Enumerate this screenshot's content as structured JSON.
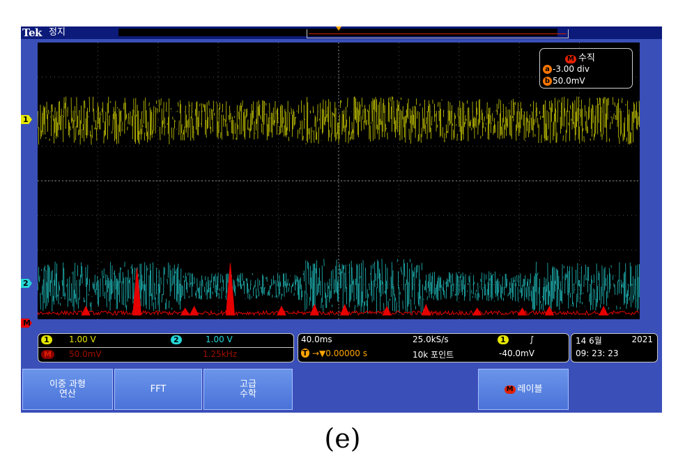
{
  "header": {
    "brand": "Tek",
    "state": "정지"
  },
  "vertical_panel": {
    "title_badge": "M",
    "title": "수직",
    "row_a_badge": "a",
    "row_a_value": "-3.00 div",
    "row_b_badge": "b",
    "row_b_value": "50.0mV"
  },
  "markers": {
    "ch1": "1",
    "ch2": "2",
    "math": "M"
  },
  "channels": {
    "ch1_badge": "1",
    "ch1_scale": "1.00 V",
    "ch2_badge": "2",
    "ch2_scale": "1.00 V",
    "math_badge": "M",
    "math_scale": "50.0mV",
    "math_freq": "1.25kHz"
  },
  "horizontal": {
    "time_div": "40.0ms",
    "sample_rate": "25.0kS/s",
    "trigger_pos_icon": "T",
    "trigger_pos": "→▼0.00000 s",
    "record_length": "10k 포인트",
    "trigger_source": "1",
    "trigger_slope": "∫",
    "trigger_level": "-40.0mV"
  },
  "datetime": {
    "date": "14 6월",
    "year": "2021",
    "time": "09: 23: 23"
  },
  "softkeys": [
    {
      "label_line1": "이중 과형",
      "label_line2": "연산"
    },
    {
      "label_line1": "FFT",
      "label_line2": ""
    },
    {
      "label_line1": "고급",
      "label_line2": "수학"
    },
    {
      "badge": "M",
      "label_line1": "레이블",
      "label_line2": ""
    }
  ],
  "caption": "(e)",
  "colors": {
    "ch1": "#e6e600",
    "ch2": "#25d7d7",
    "math": "#e60000",
    "bezel": "#3a4fb8",
    "trigger": "#ffa500"
  },
  "waveforms": {
    "ch1": {
      "level": -3.0,
      "amplitude": 1.4,
      "segment_breaks": [
        0.22,
        0.44,
        0.64,
        0.83
      ]
    },
    "ch2": {
      "level": -4.2,
      "amplitude": 1.6,
      "segment_breaks": [
        0.24,
        0.44,
        0.64,
        0.82
      ]
    },
    "math": {
      "baseline": 0.15,
      "spikes": [
        {
          "t": 0.08,
          "h": 0.25
        },
        {
          "t": 0.165,
          "h": 1.35
        },
        {
          "t": 0.245,
          "h": 0.2
        },
        {
          "t": 0.26,
          "h": 0.25
        },
        {
          "t": 0.32,
          "h": 1.5
        },
        {
          "t": 0.405,
          "h": 0.25
        },
        {
          "t": 0.46,
          "h": 0.3
        },
        {
          "t": 0.51,
          "h": 0.3
        },
        {
          "t": 0.58,
          "h": 0.25
        },
        {
          "t": 0.645,
          "h": 0.3
        },
        {
          "t": 0.73,
          "h": 0.2
        },
        {
          "t": 0.805,
          "h": 0.2
        },
        {
          "t": 0.85,
          "h": 0.25
        },
        {
          "t": 0.94,
          "h": 0.25
        }
      ]
    }
  }
}
